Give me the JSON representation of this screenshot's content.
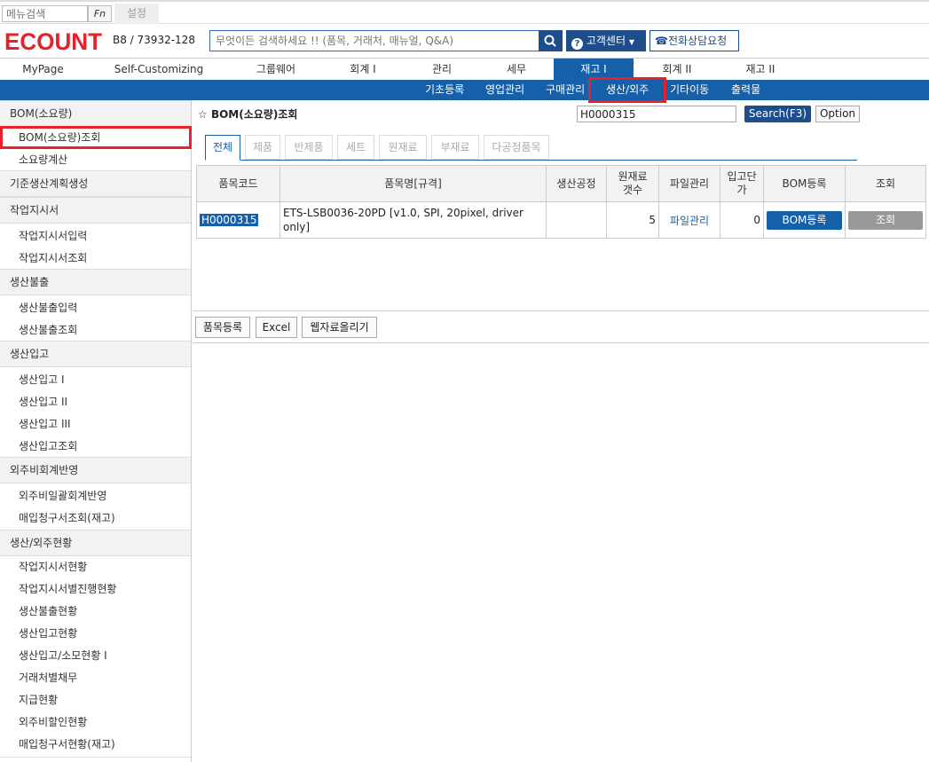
{
  "topbar": {
    "menu_search_placeholder": "메뉴검색",
    "fn_label": "Fn",
    "settings_label": "설정"
  },
  "header": {
    "logo_text": "ECOUNT",
    "company_code": "B8 / 73932-128",
    "search_placeholder": "무엇이든 검색하세요 !! (품목, 거래처, 매뉴얼, Q&A)",
    "customer_center_label": "고객센터",
    "phone_consult_label": "전화상담요청",
    "brand_color": "#1660a9",
    "accent_color": "#e8202a"
  },
  "mainnav": {
    "items": [
      "MyPage",
      "Self-Customizing",
      "그룹웨어",
      "회계 I",
      "관리",
      "세무",
      "재고 I",
      "회계 II",
      "재고 II"
    ],
    "active": "재고 I"
  },
  "subnav": {
    "items": [
      "기초등록",
      "영업관리",
      "구매관리",
      "생산/외주",
      "기타이동",
      "출력물"
    ],
    "active": "생산/외주"
  },
  "sidebar": {
    "groups": [
      {
        "title": "BOM(소요량)",
        "items": [
          "BOM(소요량)조회",
          "소요량계산"
        ]
      },
      {
        "title": "기준생산계획생성",
        "items": []
      },
      {
        "title": "작업지시서",
        "items": [
          "작업지시서입력",
          "작업지시서조회"
        ]
      },
      {
        "title": "생산불출",
        "items": [
          "생산불출입력",
          "생산불출조회"
        ]
      },
      {
        "title": "생산입고",
        "items": [
          "생산입고 I",
          "생산입고 II",
          "생산입고 III",
          "생산입고조회"
        ]
      },
      {
        "title": "외주비회계반영",
        "items": [
          "외주비일괄회계반영",
          "매입청구서조회(재고)"
        ]
      },
      {
        "title": "생산/외주현황",
        "items": [
          "작업지시서현황",
          "작업지시서별진행현황",
          "생산불출현황",
          "생산입고현황",
          "생산입고/소모현황 I",
          "거래처별채무",
          "지급현황",
          "외주비할인현황",
          "매입청구서현황(재고)"
        ]
      }
    ],
    "selected": "BOM(소요량)조회"
  },
  "content": {
    "title": "BOM(소요량)조회",
    "code_value": "H0000315",
    "search_label": "Search(F3)",
    "option_label": "Option",
    "tabs": [
      "전체",
      "제품",
      "반제품",
      "세트",
      "원재료",
      "부재료",
      "다공정품목"
    ],
    "active_tab": "전체",
    "table": {
      "headers": [
        "품목코드",
        "품목명[규격]",
        "생산공정",
        "원재료 갯수",
        "파일관리",
        "입고단가",
        "BOM등록",
        "조회"
      ],
      "rows": [
        {
          "code": "H0000315",
          "name": "ETS-LSB0036-20PD [v1.0, SPI, 20pixel, driver only]",
          "process": "",
          "material_count": "5",
          "file_manage": "파일관리",
          "unit_price": "0",
          "bom_button": "BOM등록",
          "view_button": "조회"
        }
      ]
    },
    "bottom_buttons": [
      "품목등록",
      "Excel",
      "웹자료올리기"
    ]
  }
}
